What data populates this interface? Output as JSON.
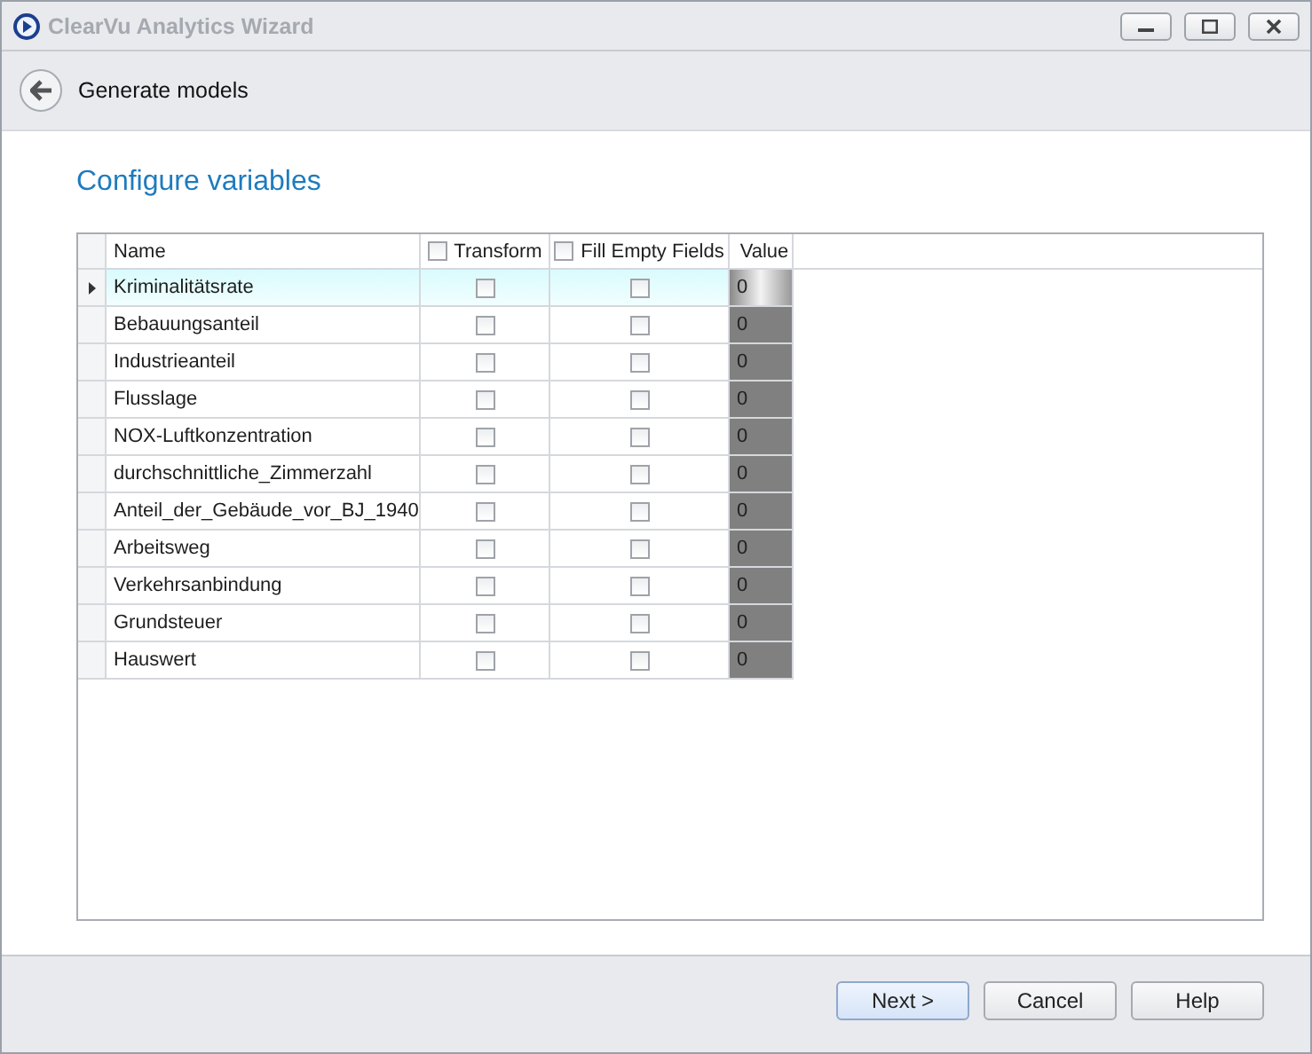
{
  "window": {
    "title": "ClearVu Analytics Wizard"
  },
  "header": {
    "title": "Generate models"
  },
  "section_title": "Configure variables",
  "table": {
    "columns": [
      {
        "kind": "text",
        "label": "Name"
      },
      {
        "kind": "check",
        "label": "Transform",
        "checked": false
      },
      {
        "kind": "check",
        "label": "Fill Empty Fields",
        "checked": false
      },
      {
        "kind": "text",
        "label": "Value"
      }
    ],
    "rows": [
      {
        "name": "Kriminalitätsrate",
        "transform": false,
        "fill_empty": false,
        "value": "0",
        "selected": true
      },
      {
        "name": "Bebauungsanteil",
        "transform": false,
        "fill_empty": false,
        "value": "0",
        "selected": false
      },
      {
        "name": "Industrieanteil",
        "transform": false,
        "fill_empty": false,
        "value": "0",
        "selected": false
      },
      {
        "name": "Flusslage",
        "transform": false,
        "fill_empty": false,
        "value": "0",
        "selected": false
      },
      {
        "name": "NOX-Luftkonzentration",
        "transform": false,
        "fill_empty": false,
        "value": "0",
        "selected": false
      },
      {
        "name": "durchschnittliche_Zimmerzahl",
        "transform": false,
        "fill_empty": false,
        "value": "0",
        "selected": false
      },
      {
        "name": "Anteil_der_Gebäude_vor_BJ_1940",
        "transform": false,
        "fill_empty": false,
        "value": "0",
        "selected": false
      },
      {
        "name": "Arbeitsweg",
        "transform": false,
        "fill_empty": false,
        "value": "0",
        "selected": false
      },
      {
        "name": "Verkehrsanbindung",
        "transform": false,
        "fill_empty": false,
        "value": "0",
        "selected": false
      },
      {
        "name": "Grundsteuer",
        "transform": false,
        "fill_empty": false,
        "value": "0",
        "selected": false
      },
      {
        "name": "Hauswert",
        "transform": false,
        "fill_empty": false,
        "value": "0",
        "selected": false
      }
    ]
  },
  "buttons": [
    {
      "label": "Next >",
      "kind": "primary"
    },
    {
      "label": "Cancel",
      "kind": "normal"
    },
    {
      "label": "Help",
      "kind": "normal"
    }
  ]
}
